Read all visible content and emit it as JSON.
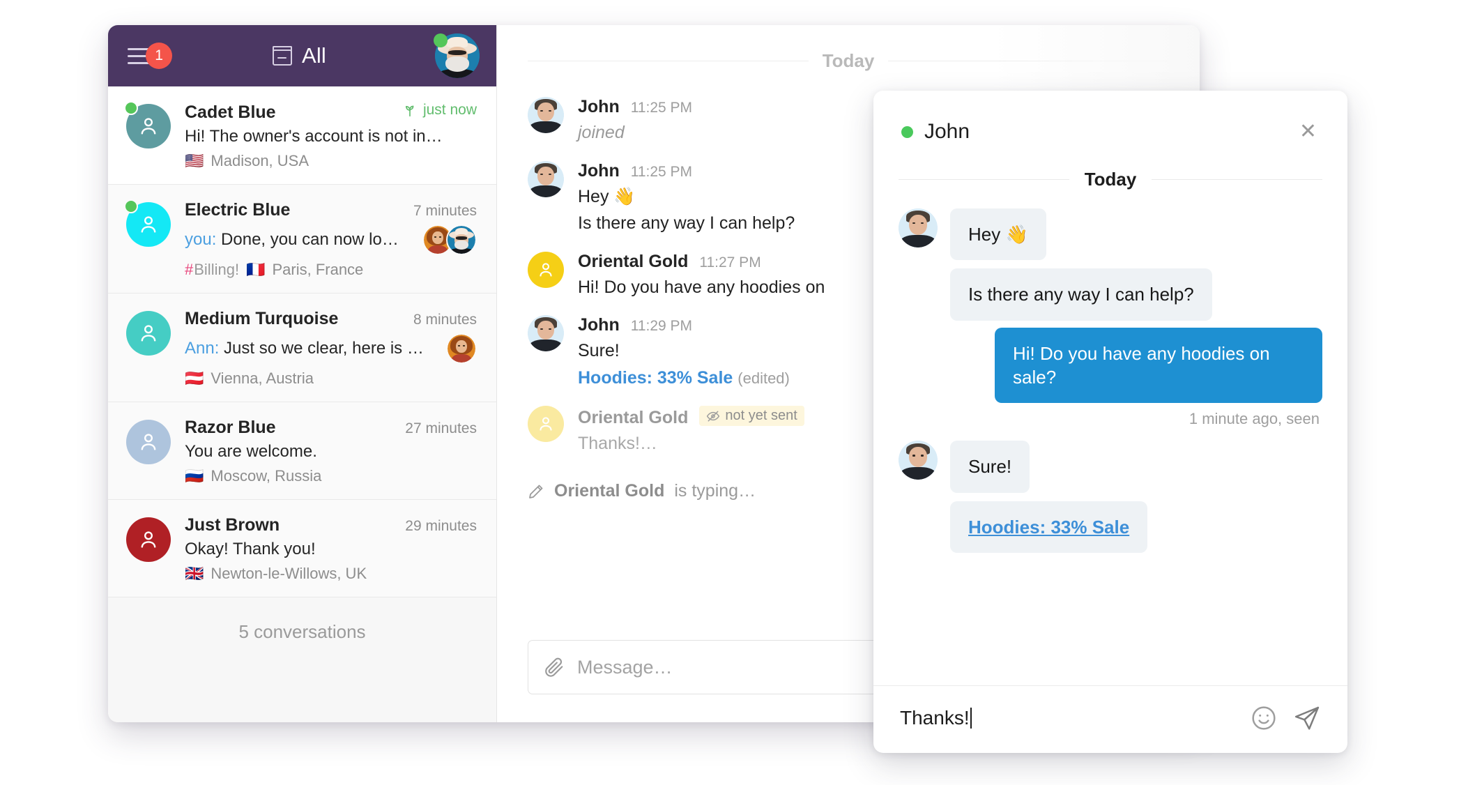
{
  "sidebar": {
    "header": {
      "badge_count": "1",
      "menu_icon": "hamburger-icon",
      "inbox_icon": "inbox-icon",
      "filter_label": "All",
      "avatar_icon": "user-avatar"
    },
    "conversations": [
      {
        "name": "Cadet Blue",
        "time": "just now",
        "time_fresh": true,
        "time_icon": "sprout-icon",
        "snippet_prefix": "",
        "snippet": "Hi! The owner's account is not in…",
        "tag": "",
        "flag": "🇺🇸",
        "location": "Madison, USA",
        "avatar_color": "#5e9ca0",
        "online": true,
        "active": true,
        "participants": []
      },
      {
        "name": "Electric Blue",
        "time": "7 minutes",
        "time_fresh": false,
        "snippet_prefix": "you:",
        "snippet": "Done, you can now lo…",
        "tag": "Billing!",
        "flag": "🇫🇷",
        "location": "Paris, France",
        "avatar_color": "#14e8f5",
        "online": true,
        "active": false,
        "participants": [
          "ann",
          "oldman"
        ]
      },
      {
        "name": "Medium Turquoise",
        "time": "8 minutes",
        "time_fresh": false,
        "snippet_prefix": "Ann:",
        "snippet": "Just so we clear, here is …",
        "tag": "",
        "flag": "🇦🇹",
        "location": "Vienna, Austria",
        "avatar_color": "#45cdc4",
        "online": false,
        "active": false,
        "participants": [
          "ann"
        ]
      },
      {
        "name": "Razor Blue",
        "time": "27 minutes",
        "time_fresh": false,
        "snippet_prefix": "",
        "snippet": "You are welcome.",
        "tag": "",
        "flag": "🇷🇺",
        "location": "Moscow, Russia",
        "avatar_color": "#aec4dd",
        "online": false,
        "active": false,
        "participants": []
      },
      {
        "name": "Just Brown",
        "time": "29 minutes",
        "time_fresh": false,
        "snippet_prefix": "",
        "snippet": "Okay! Thank you!",
        "tag": "",
        "flag": "🇬🇧",
        "location": "Newton-le-Willows, UK",
        "avatar_color": "#b02025",
        "online": false,
        "active": false,
        "participants": []
      }
    ],
    "footer_count": "5 conversations"
  },
  "chat_main": {
    "day_label": "Today",
    "messages": [
      {
        "author": "John",
        "time": "11:25 PM",
        "text": "joined",
        "style": "italic",
        "avatar": "john",
        "muted_author": false
      },
      {
        "author": "John",
        "time": "11:25 PM",
        "text": "Hey 👋",
        "text2": "Is there any way I can help?",
        "style": "normal",
        "avatar": "john",
        "muted_author": false
      },
      {
        "author": "Oriental Gold",
        "time": "11:27 PM",
        "text": "Hi! Do you have any hoodies on",
        "style": "normal",
        "avatar": "gold",
        "muted_author": false
      },
      {
        "author": "John",
        "time": "11:29 PM",
        "text": "Sure!",
        "link_text": "Hoodies: 33% Sale",
        "edited_label": "(edited)",
        "style": "normal",
        "avatar": "john",
        "muted_author": false
      },
      {
        "author": "Oriental Gold",
        "time": "",
        "status_chip": "not yet sent",
        "status_icon": "eye-slash-icon",
        "text": "Thanks!…",
        "style": "muted",
        "avatar": "gold-faded",
        "muted_author": true
      }
    ],
    "typing_icon": "pencil-icon",
    "typing_who": "Oriental Gold",
    "typing_suffix": " is typing…",
    "composer": {
      "attach_icon": "paperclip-icon",
      "placeholder": "Message…"
    }
  },
  "popup": {
    "title": "John",
    "online_indicator": "online-dot",
    "close_icon": "close-icon",
    "day_label": "Today",
    "messages": [
      {
        "side": "in",
        "text": "Hey 👋",
        "avatar": "john",
        "show_avatar": true
      },
      {
        "side": "in",
        "text": "Is there any way I can help?",
        "avatar": "john",
        "show_avatar": false
      },
      {
        "side": "out",
        "text": "Hi! Do you have any hoodies on sale?",
        "meta": "1 minute ago, seen"
      },
      {
        "side": "in",
        "text": "Sure!",
        "avatar": "john",
        "show_avatar": true
      },
      {
        "side": "in",
        "link_text": "Hoodies: 33% Sale",
        "avatar": "john",
        "show_avatar": false
      }
    ],
    "composer": {
      "value": "Thanks!",
      "emoji_icon": "smiley-icon",
      "send_icon": "send-icon"
    }
  },
  "colors": {
    "header_purple": "#4b3763",
    "badge_red": "#f4544a",
    "accent_blue": "#1e90d2",
    "link_blue": "#3d8fd8",
    "online_green": "#4ac95c",
    "fresh_green": "#62bd6e",
    "tag_pink": "#e8467c"
  }
}
